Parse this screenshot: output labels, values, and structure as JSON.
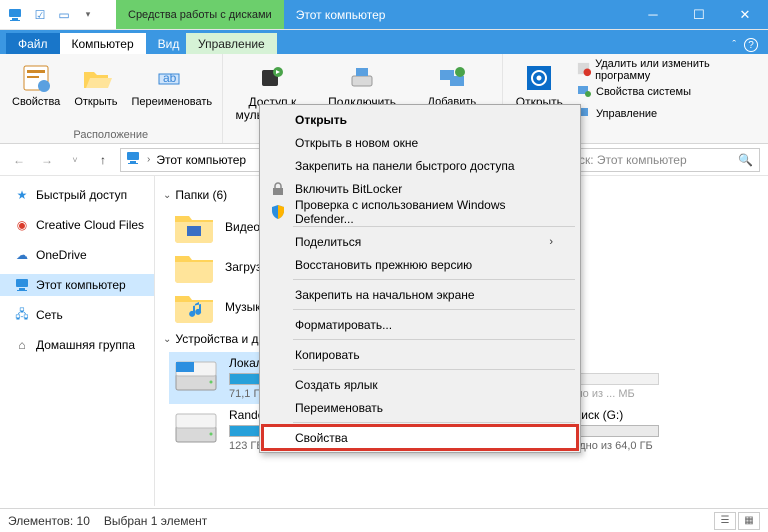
{
  "title": {
    "contextual": "Средства работы с дисками",
    "window": "Этот компьютер"
  },
  "tabs": {
    "file": "Файл",
    "computer": "Компьютер",
    "view": "Вид",
    "manage": "Управление"
  },
  "ribbon": {
    "group_location": "Расположение",
    "props": "Свойства",
    "open": "Открыть",
    "rename": "Переименовать",
    "media": "Доступ к мультимедиа",
    "mapdrive": "Подключить сетевой",
    "addnet": "Добавить сетевое",
    "open2": "Открыть",
    "uninstall": "Удалить или изменить программу",
    "sysprops": "Свойства системы",
    "manage": "Управление"
  },
  "address": {
    "location": "Этот компьютер"
  },
  "search": {
    "placeholder": "Поиск: Этот компьютер"
  },
  "nav": {
    "quick": "Быстрый доступ",
    "ccf": "Creative Cloud Files",
    "onedrive": "OneDrive",
    "thispc": "Этот компьютер",
    "network": "Сеть",
    "homegroup": "Домашняя группа"
  },
  "sections": {
    "folders": "Папки (6)",
    "devices": "Устройства и диски"
  },
  "folders": {
    "video": "Видео",
    "downloads": "Загрузки",
    "music": "Музыка"
  },
  "drives": {
    "c": {
      "name": "Локальный",
      "sub": "71,1 ГБ свободно из ..."
    },
    "f": {
      "name": "Random Data (F:)",
      "sub": "123 ГБ свободно из 401 ГБ"
    },
    "g": {
      "name": "Локальный диск (G:)",
      "sub": "46,1 ГБ свободно из 64,0 ГБ"
    },
    "hidden": {
      "sub": "... МБ свободно из ... МБ"
    }
  },
  "ctx": {
    "open": "Открыть",
    "newwin": "Открыть в новом окне",
    "pin": "Закрепить на панели быстрого доступа",
    "bitlocker": "Включить BitLocker",
    "defender": "Проверка с использованием Windows Defender...",
    "share": "Поделиться",
    "restore": "Восстановить прежнюю версию",
    "pinstart": "Закрепить на начальном экране",
    "format": "Форматировать...",
    "copy": "Копировать",
    "shortcut": "Создать ярлык",
    "rename": "Переименовать",
    "props": "Свойства"
  },
  "status": {
    "count": "Элементов: 10",
    "selected": "Выбран 1 элемент"
  }
}
